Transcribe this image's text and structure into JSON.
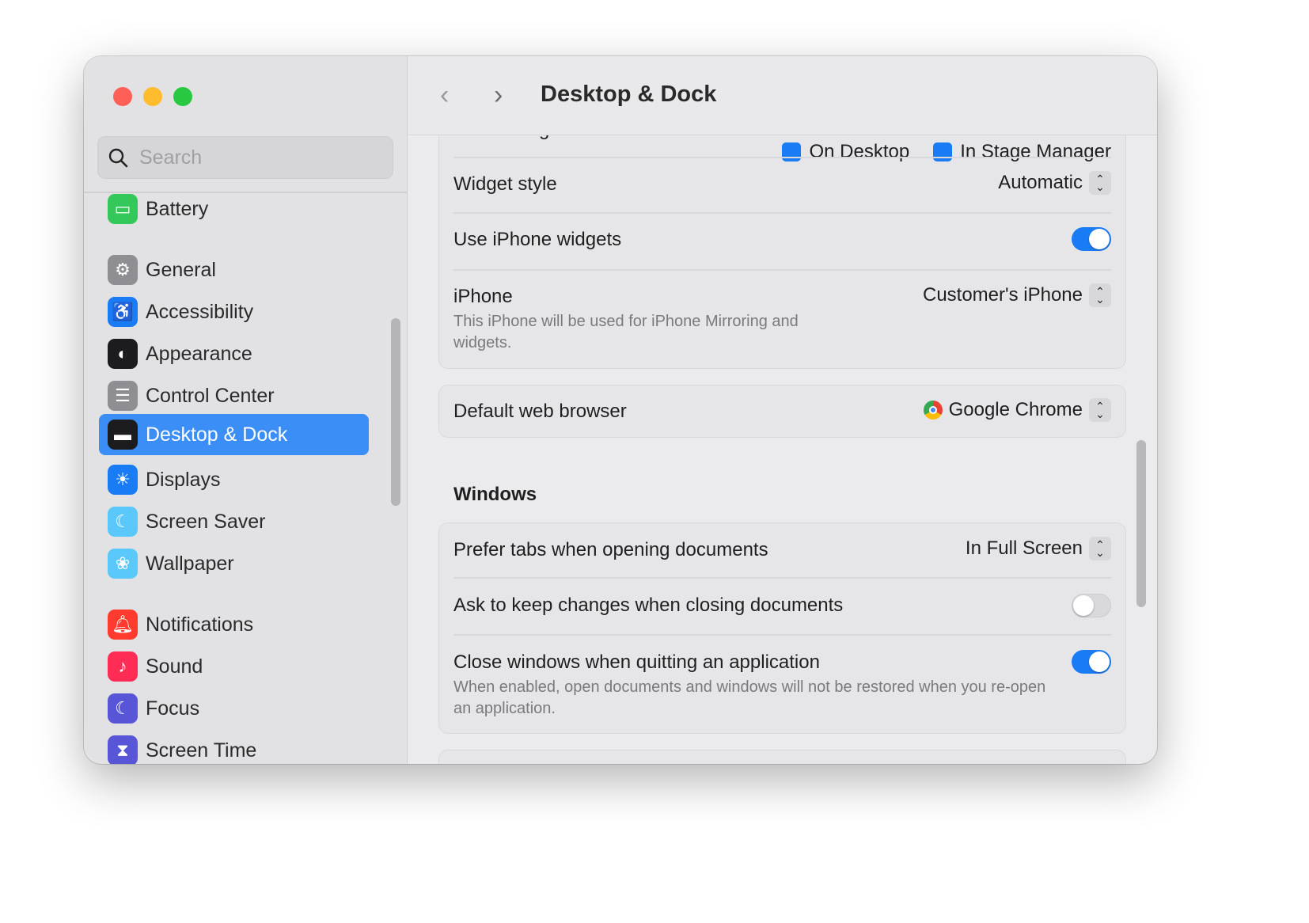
{
  "window": {
    "title": "Desktop & Dock",
    "colors": {
      "close": "#fe5f57",
      "minimize": "#febc2e",
      "zoom": "#28c840",
      "accent": "#3a8ef6"
    }
  },
  "search": {
    "placeholder": "Search",
    "icon": "magnifier-icon"
  },
  "sidebar": {
    "items": [
      {
        "label": "Battery",
        "icon": "battery-icon",
        "color": "#34c759"
      },
      {
        "label": "General",
        "icon": "gear-icon",
        "color": "#8e8e93"
      },
      {
        "label": "Accessibility",
        "icon": "accessibility-icon",
        "color": "#1a7cf5"
      },
      {
        "label": "Appearance",
        "icon": "appearance-icon",
        "color": "#1c1c1e"
      },
      {
        "label": "Control Center",
        "icon": "control-center-icon",
        "color": "#8e8e93"
      },
      {
        "label": "Desktop & Dock",
        "icon": "dock-icon",
        "color": "#1c1c1e",
        "selected": true
      },
      {
        "label": "Displays",
        "icon": "sun-icon",
        "color": "#1a7cf5"
      },
      {
        "label": "Screen Saver",
        "icon": "screen-saver-icon",
        "color": "#5ac8fa"
      },
      {
        "label": "Wallpaper",
        "icon": "flower-icon",
        "color": "#5ac8fa"
      },
      {
        "label": "Notifications",
        "icon": "bell-icon",
        "color": "#ff3b30"
      },
      {
        "label": "Sound",
        "icon": "speaker-icon",
        "color": "#ff2d55"
      },
      {
        "label": "Focus",
        "icon": "moon-icon",
        "color": "#5856d6"
      },
      {
        "label": "Screen Time",
        "icon": "hourglass-icon",
        "color": "#5856d6"
      }
    ]
  },
  "main": {
    "show_widgets": {
      "label": "Show Widgets",
      "opt1": "On Desktop",
      "opt2": "In Stage Manager"
    },
    "widget_style": {
      "label": "Widget style",
      "value": "Automatic"
    },
    "use_iphone_widgets": {
      "label": "Use iPhone widgets",
      "on": true
    },
    "iphone": {
      "label": "iPhone",
      "value": "Customer's iPhone",
      "desc": "This iPhone will be used for iPhone Mirroring and widgets."
    },
    "browser": {
      "label": "Default web browser",
      "value": "Google Chrome"
    },
    "windows_section": "Windows",
    "prefer_tabs": {
      "label": "Prefer tabs when opening documents",
      "value": "In Full Screen"
    },
    "ask_keep": {
      "label": "Ask to keep changes when closing documents",
      "on": false
    },
    "close_windows": {
      "label": "Close windows when quitting an application",
      "on": true,
      "desc": "When enabled, open documents and windows will not be restored when you re-open an application."
    }
  }
}
